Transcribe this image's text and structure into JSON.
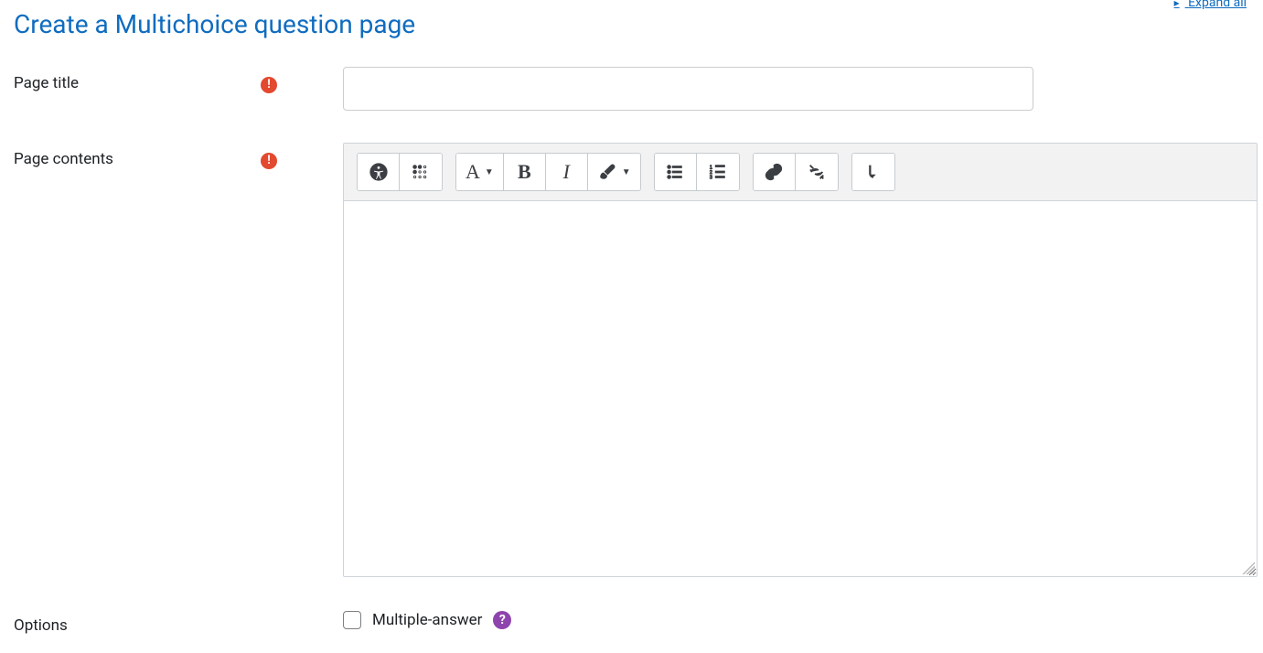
{
  "header": {
    "expand_all": "Expand all",
    "title": "Create a Multichoice question page"
  },
  "fields": {
    "page_title": {
      "label": "Page title",
      "value": ""
    },
    "page_contents": {
      "label": "Page contents",
      "value": ""
    },
    "options": {
      "label": "Options"
    },
    "multiple_answer": {
      "label": "Multiple-answer",
      "checked": false
    }
  },
  "toolbar": {
    "font_family_letter": "A"
  }
}
